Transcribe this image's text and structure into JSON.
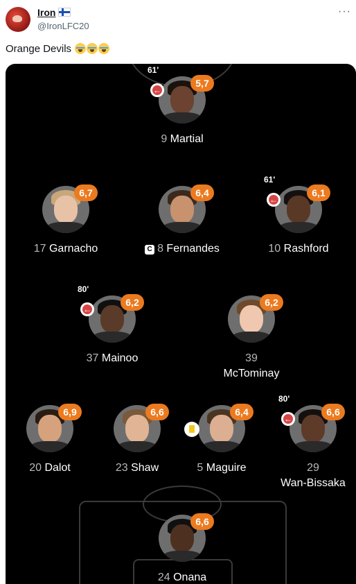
{
  "tweet": {
    "display_name": "Iron",
    "handle": "@IronLFC20",
    "text": "Orange Devils",
    "more_label": "···"
  },
  "players": [
    {
      "number": "9",
      "name": "Martial",
      "rating": "5,7",
      "sub_minute": "61'"
    },
    {
      "number": "17",
      "name": "Garnacho",
      "rating": "6,7"
    },
    {
      "number": "8",
      "name": "Fernandes",
      "rating": "6,4",
      "captain": "C"
    },
    {
      "number": "10",
      "name": "Rashford",
      "rating": "6,1",
      "sub_minute": "61'"
    },
    {
      "number": "37",
      "name": "Mainoo",
      "rating": "6,2",
      "sub_minute": "80'"
    },
    {
      "number": "39",
      "name": "McTominay",
      "rating": "6,2"
    },
    {
      "number": "20",
      "name": "Dalot",
      "rating": "6,9"
    },
    {
      "number": "23",
      "name": "Shaw",
      "rating": "6,6"
    },
    {
      "number": "5",
      "name": "Maguire",
      "rating": "6,4",
      "yellow_card": "yellow-card-icon"
    },
    {
      "number": "29",
      "name": "Wan-Bissaka",
      "rating": "6,6",
      "sub_minute": "80'"
    },
    {
      "number": "24",
      "name": "Onana",
      "rating": "6,6"
    }
  ],
  "colors": {
    "rating_badge": "#ec7a1f",
    "pitch": "#000000",
    "sub_icon": "#d64545"
  },
  "icons": {
    "substitution": "sub-off-arrow-icon",
    "captain": "captain-badge-icon",
    "yellow_card": "yellow-card-icon"
  }
}
